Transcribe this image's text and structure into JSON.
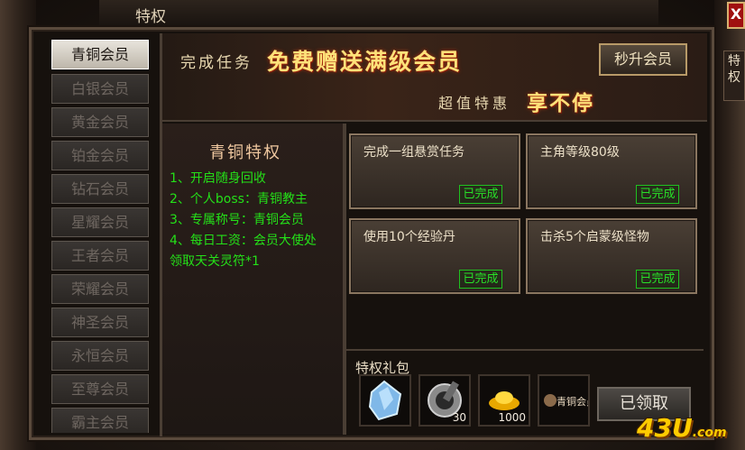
{
  "window": {
    "title": "特权",
    "close_label": "X",
    "side_tab": "特权"
  },
  "sidebar": {
    "items": [
      {
        "label": "青铜会员",
        "active": true
      },
      {
        "label": "白银会员"
      },
      {
        "label": "黄金会员"
      },
      {
        "label": "铂金会员"
      },
      {
        "label": "钻石会员"
      },
      {
        "label": "星耀会员"
      },
      {
        "label": "王者会员"
      },
      {
        "label": "荣耀会员"
      },
      {
        "label": "神圣会员"
      },
      {
        "label": "永恒会员"
      },
      {
        "label": "至尊会员"
      },
      {
        "label": "霸主会员"
      }
    ]
  },
  "banner": {
    "line1_prefix": "完成任务",
    "line1_highlight": "免费赠送满级会员",
    "line2_prefix": "超值特惠",
    "line2_highlight": "享不停",
    "upgrade_button": "秒升会员"
  },
  "privilege": {
    "title": "青铜特权",
    "lines": [
      "1、开启随身回收",
      "2、个人boss：青铜教主",
      "3、专属称号：青铜会员",
      "4、每日工资：会员大使处",
      "领取天关灵符*1"
    ]
  },
  "tasks": [
    {
      "text": "完成一组悬赏任务",
      "status": "已完成"
    },
    {
      "text": "主角等级80级",
      "status": "已完成"
    },
    {
      "text": "使用10个经验丹",
      "status": "已完成"
    },
    {
      "text": "击杀5个启蒙级怪物",
      "status": "已完成"
    }
  ],
  "gift": {
    "label": "特权礼包",
    "items": [
      {
        "icon": "crystal-icon",
        "count": ""
      },
      {
        "icon": "bracer-icon",
        "count": "30"
      },
      {
        "icon": "gold-ingot-icon",
        "count": "1000"
      },
      {
        "icon": "bronze-title-icon",
        "title_text": "青铜会员",
        "count": ""
      }
    ],
    "claimed_button": "已领取"
  },
  "watermark": {
    "main": "43U",
    "suffix": ".com"
  },
  "colors": {
    "highlight": "#ffe27a",
    "green": "#24e018",
    "close_red": "#a01010"
  }
}
